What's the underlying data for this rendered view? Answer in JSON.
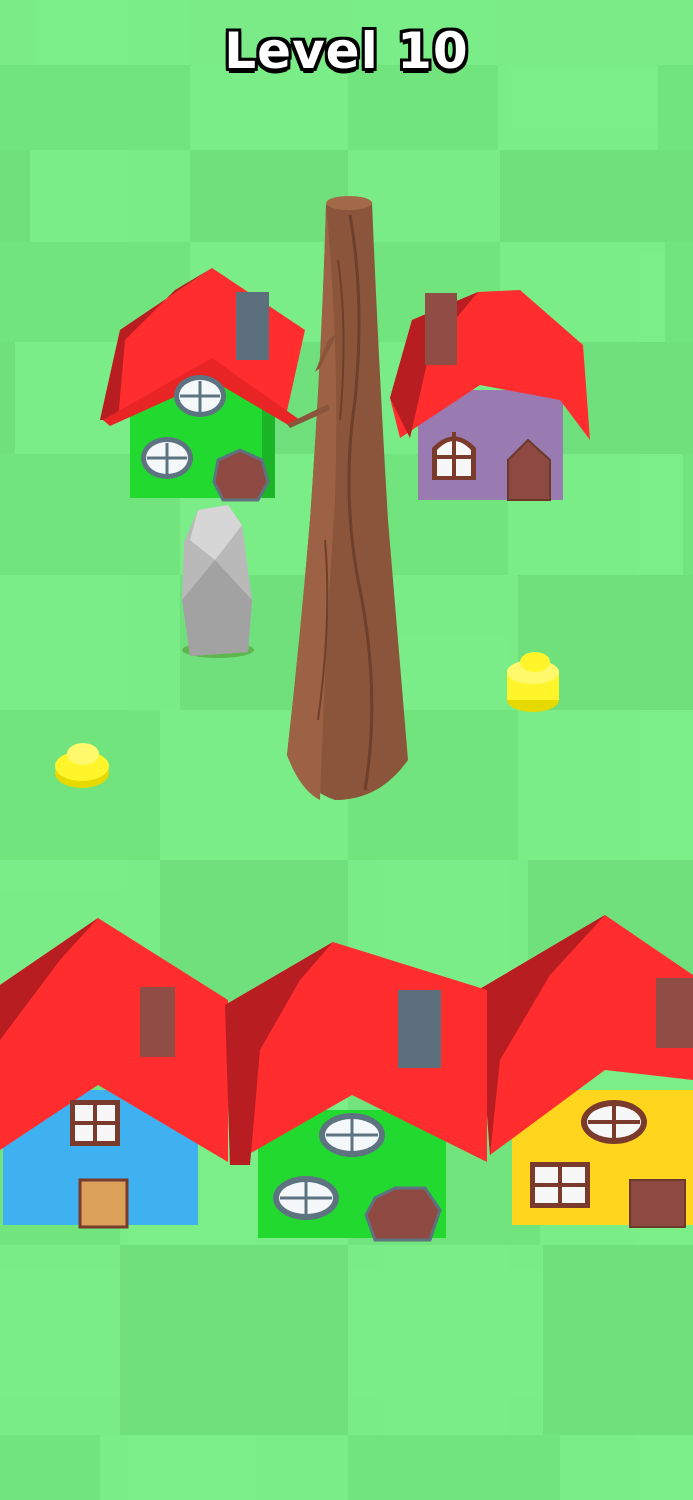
{
  "hud": {
    "level_label": "Level 10"
  },
  "colors": {
    "grass_light": "#79e985",
    "grass_dark": "#6cdc79",
    "roof_red": "#ff2d2d",
    "roof_shadow": "#b81d21",
    "wall_green": "#22d92f",
    "wall_purple": "#9a7bb1",
    "wall_blue": "#3fb1f0",
    "wall_yellow": "#ffd51e",
    "chimney_gray": "#5b6f7c",
    "chimney_brown": "#8f4d45",
    "trunk_brown": "#8a553b",
    "coin_yellow": "#fff52a",
    "rock_gray": "#b9b9b9"
  },
  "scene": {
    "houses": [
      {
        "name": "house-green-top-left",
        "wall": "green"
      },
      {
        "name": "house-purple-top-right",
        "wall": "purple"
      },
      {
        "name": "house-blue-bottom-left",
        "wall": "blue"
      },
      {
        "name": "house-green-bottom-center",
        "wall": "green"
      },
      {
        "name": "house-yellow-bottom-right",
        "wall": "yellow"
      }
    ],
    "objects": [
      "tree-trunk",
      "rock",
      "coin-left",
      "coin-right"
    ]
  }
}
